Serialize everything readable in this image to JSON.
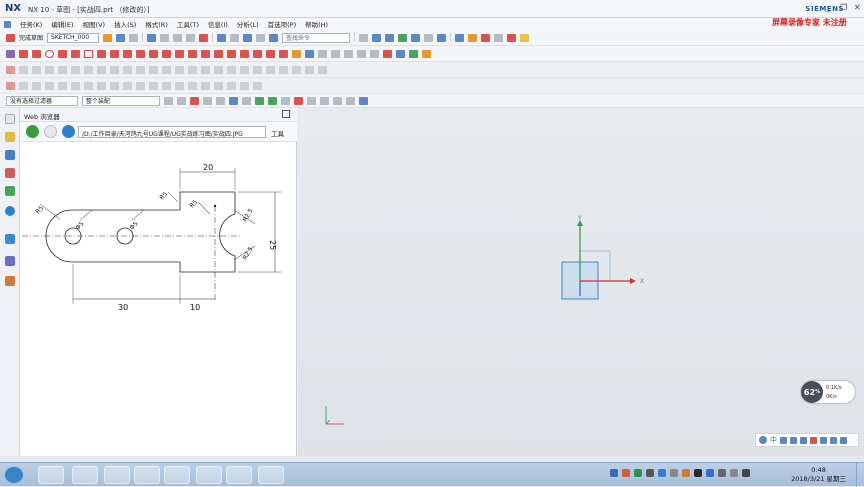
{
  "titlebar": {
    "app_logo": "NX",
    "title": "NX 10 - 草图 - [实战四.prt （修改的）]",
    "brand": "SIEMENS",
    "watermark": "屏幕录像专家 未注册",
    "minimize": "_",
    "restore": "❐",
    "close": "✕"
  },
  "menu": [
    "任务(K)",
    "编辑(E)",
    "视图(V)",
    "插入(S)",
    "格式(R)",
    "工具(T)",
    "信息(I)",
    "分析(L)",
    "首选项(P)",
    "帮助(H)"
  ],
  "toolbar1": {
    "finish_sketch_label": "完成草图",
    "sketch_name": "SKETCH_000",
    "search_placeholder": "查找命令"
  },
  "toolbar4": {
    "filter_label": "没有选择过滤器",
    "assembly_label": "整个装配"
  },
  "webpanel": {
    "title": "Web 浏览器",
    "url": "/D:/工作目录/天河鸽九号UG课程/UG实战练习图/实战四.JPG",
    "tools_label": "工具"
  },
  "drawing": {
    "dim_top": "20",
    "dim_bottom_left": "30",
    "dim_bottom_right": "10",
    "dim_height": "25",
    "r_left": "R5",
    "d_hole1": "Φ5",
    "d_hole2": "Φ5",
    "r_mid": "R5",
    "r_right": "R5",
    "r_top_right": "R2.5",
    "r_bot_right": "R2.5"
  },
  "axes": {
    "x_label": "X",
    "y_label": "Y"
  },
  "speed_widget": {
    "value": "62",
    "unit": "%",
    "up": "0.1K/s",
    "down": "0K/s"
  },
  "ime": {
    "lang": "中"
  },
  "clock": {
    "time": "0:48",
    "date": "2018/3/21 星期三"
  }
}
